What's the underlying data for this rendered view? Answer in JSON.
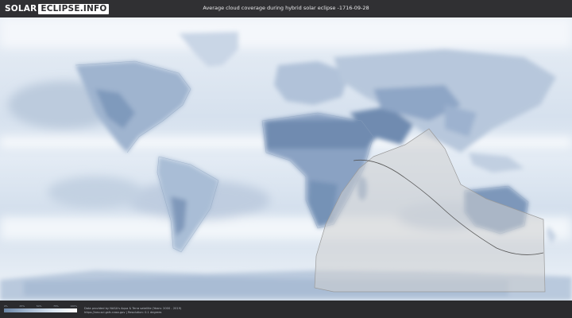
{
  "header": {
    "logo_part1": "SOLAR",
    "logo_part2": "ECLIPSE.INFO",
    "title": "Average cloud coverage during hybrid solar eclipse -1716-09-28"
  },
  "legend": {
    "ticks": [
      "0%",
      "25%",
      "50%",
      "75%",
      "100%"
    ],
    "colors": [
      "#6c86a6",
      "#a4b8d0",
      "#d8e4f0",
      "#ffffff"
    ]
  },
  "footer": {
    "credit_line1": "Data provided by NASA's Aqua & Terra satellite (Years: 2000 - 2019)",
    "credit_line2": "https://neo.sci.gsfc.nasa.gov | Resolution: 0.1 degrees"
  },
  "map": {
    "clear_sky_color": "#7590b4",
    "cloud_color": "#ffffff",
    "eclipse_zone_color": "#cfcfcf",
    "path_color": "#555555"
  }
}
